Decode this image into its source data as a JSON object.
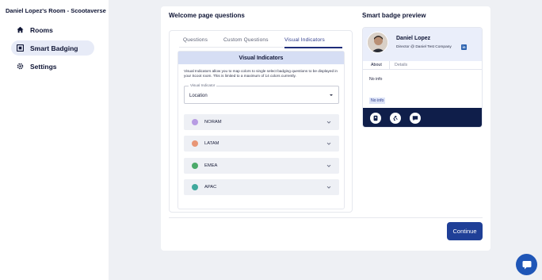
{
  "sidebar": {
    "room_title": "Daniel Lopez's Room - Scootaverse",
    "items": [
      {
        "label": "Rooms",
        "icon": "home-icon"
      },
      {
        "label": "Smart Badging",
        "icon": "badge-icon"
      },
      {
        "label": "Settings",
        "icon": "gear-icon"
      }
    ]
  },
  "main": {
    "section_title": "Welcome page questions",
    "tabs": [
      {
        "label": "Questions"
      },
      {
        "label": "Custom Questions"
      },
      {
        "label": "Visual Indicators"
      }
    ],
    "visual_indicators": {
      "header": "Visual Indicators",
      "description": "Visual Indicators allow you to map colors to single select badging questions to be displayed in your Scoot room. This is limited to a maximum of 14 colors currently.",
      "select_label": "Visual Indicator",
      "select_value": "Location",
      "regions": [
        {
          "label": "NORAM",
          "color": "#b79be3"
        },
        {
          "label": "LATAM",
          "color": "#e89676"
        },
        {
          "label": "EMEA",
          "color": "#4caa6a"
        },
        {
          "label": "APAC",
          "color": "#40a99d"
        }
      ]
    },
    "continue_label": "Continue"
  },
  "preview": {
    "title": "Smart badge preview",
    "name": "Daniel Lopez",
    "role": "Director @ Daniel Test Company",
    "linkedin_text": "in",
    "tabs": [
      "About",
      "Details"
    ],
    "about_text": "No info",
    "highlight_text": "No info"
  },
  "colors": {
    "accent": "#1f3f97",
    "badge_footer": "#0f1e4a",
    "header_bg": "#d6def4"
  }
}
